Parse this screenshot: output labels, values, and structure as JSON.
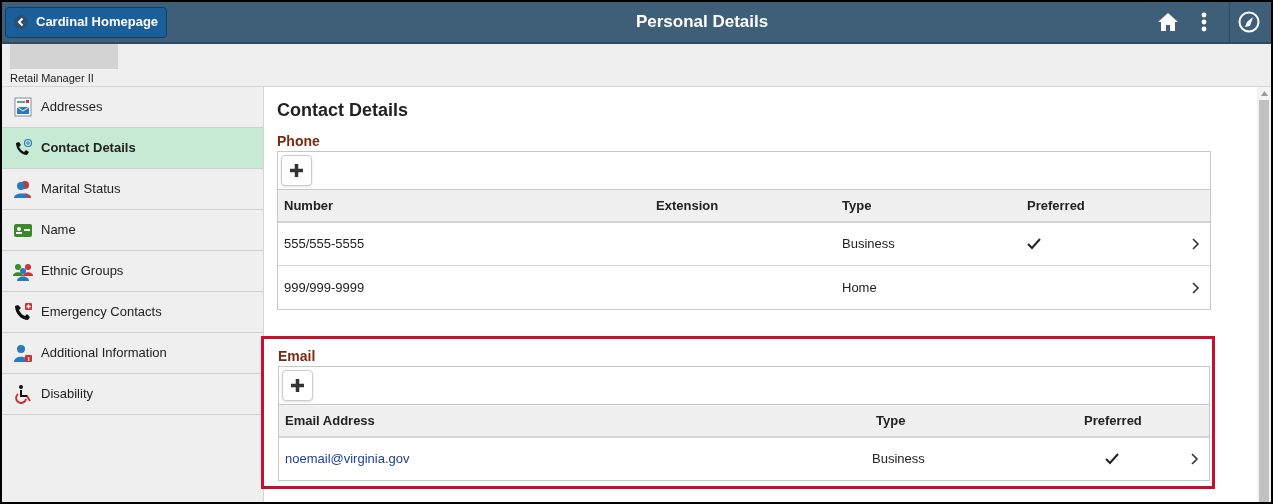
{
  "header": {
    "back_label": "Cardinal Homepage",
    "title": "Personal Details"
  },
  "subheader": {
    "role": "Retail Manager II"
  },
  "sidebar": {
    "items": [
      {
        "label": "Addresses",
        "kind": "addresses",
        "selected": false
      },
      {
        "label": "Contact Details",
        "kind": "contact",
        "selected": true
      },
      {
        "label": "Marital Status",
        "kind": "marital",
        "selected": false
      },
      {
        "label": "Name",
        "kind": "name",
        "selected": false
      },
      {
        "label": "Ethnic Groups",
        "kind": "ethnic",
        "selected": false
      },
      {
        "label": "Emergency Contacts",
        "kind": "emergency",
        "selected": false
      },
      {
        "label": "Additional Information",
        "kind": "additional",
        "selected": false
      },
      {
        "label": "Disability",
        "kind": "disability",
        "selected": false
      }
    ]
  },
  "page_title": "Contact Details",
  "phone": {
    "title": "Phone",
    "columns": [
      "Number",
      "Extension",
      "Type",
      "Preferred"
    ],
    "rows": [
      {
        "number": "555/555-5555",
        "type": "Business",
        "preferred": true
      },
      {
        "number": "999/999-9999",
        "type": "Home",
        "preferred": false
      }
    ]
  },
  "email": {
    "title": "Email",
    "highlighted": true,
    "columns": [
      "Email Address",
      "Type",
      "Preferred"
    ],
    "rows": [
      {
        "address": "noemail@virginia.gov",
        "type": "Business",
        "preferred": true
      }
    ]
  }
}
